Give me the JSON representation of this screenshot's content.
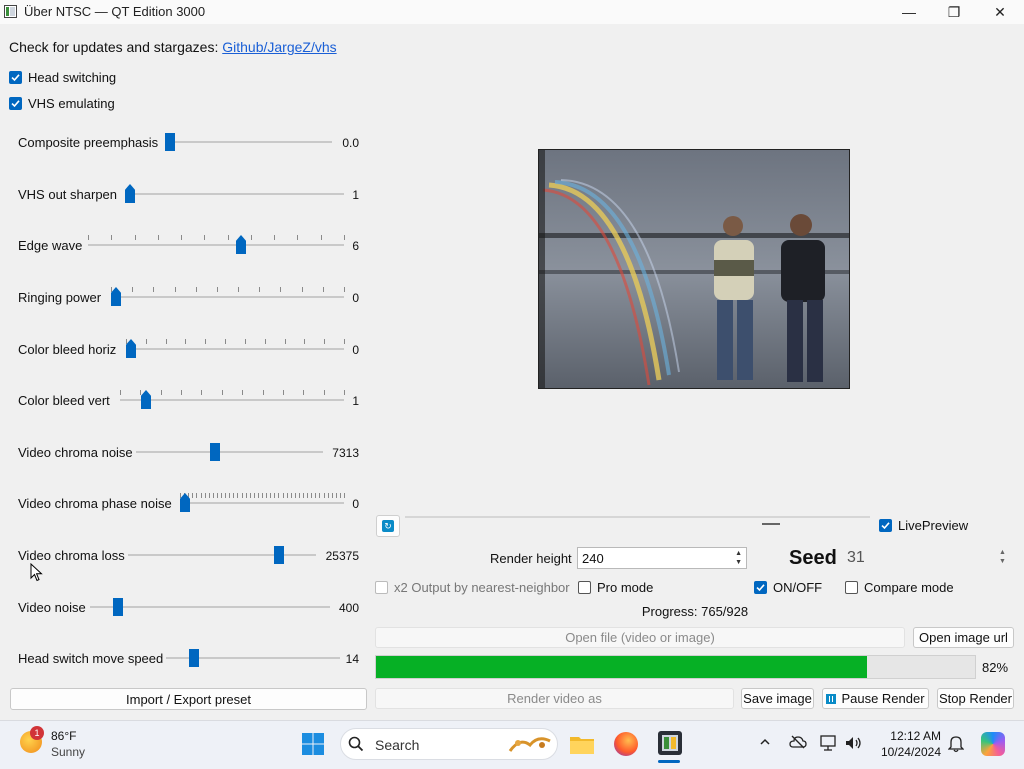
{
  "window": {
    "title": "Über NTSC — QT Edition 3000",
    "minimize_glyph": "—",
    "maximize_glyph": "❐",
    "close_glyph": "✕"
  },
  "header": {
    "updates_text": "Check for updates and stargazes:",
    "updates_link": "Github/JargeZ/vhs"
  },
  "toggles": [
    {
      "label": "Head switching",
      "checked": true
    },
    {
      "label": "VHS emulating",
      "checked": true
    }
  ],
  "sliders": [
    {
      "label": "Composite preemphasis",
      "value": "0.0",
      "position": 0.0
    },
    {
      "label": "VHS out sharpen",
      "value": "1",
      "position": 0.0
    },
    {
      "label": "Edge wave",
      "value": "6",
      "position": 0.6
    },
    {
      "label": "Ringing power",
      "value": "0",
      "position": 0.0
    },
    {
      "label": "Color bleed horiz",
      "value": "0",
      "position": 0.0
    },
    {
      "label": "Color bleed vert",
      "value": "1",
      "position": 0.1
    },
    {
      "label": "Video chroma noise",
      "value": "7313",
      "position": 0.42
    },
    {
      "label": "Video chroma phase noise",
      "value": "0",
      "position": 0.0
    },
    {
      "label": "Video chroma loss",
      "value": "25375",
      "position": 0.82
    },
    {
      "label": "Video noise",
      "value": "400",
      "position": 0.1
    },
    {
      "label": "Head switch move speed",
      "value": "14",
      "position": 0.14
    }
  ],
  "import_export_label": "Import / Export preset",
  "preview": {
    "live_preview_label": "LivePreview",
    "live_preview_checked": true
  },
  "render": {
    "height_label": "Render height",
    "height_value": "240",
    "seed_label": "Seed",
    "seed_value": "31",
    "x2_label": "x2 Output by nearest-neighbor",
    "pro_mode_label": "Pro mode",
    "onoff_label": "ON/OFF",
    "compare_label": "Compare mode",
    "progress_text": "Progress: 765/928",
    "progress_percent_label": "82%",
    "progress_fraction": 0.82
  },
  "buttons": {
    "open_file": "Open file (video or image)",
    "open_image_url": "Open image url",
    "render_video_as": "Render video as",
    "save_image": "Save image",
    "pause_render": "Pause Render",
    "stop_render": "Stop Render"
  },
  "taskbar": {
    "weather_temp": "86°F",
    "weather_desc": "Sunny",
    "weather_badge": "1",
    "search_placeholder": "Search",
    "time": "12:12 AM",
    "date": "10/24/2024"
  },
  "colors": {
    "accent": "#0067c0",
    "progress": "#06b025"
  }
}
